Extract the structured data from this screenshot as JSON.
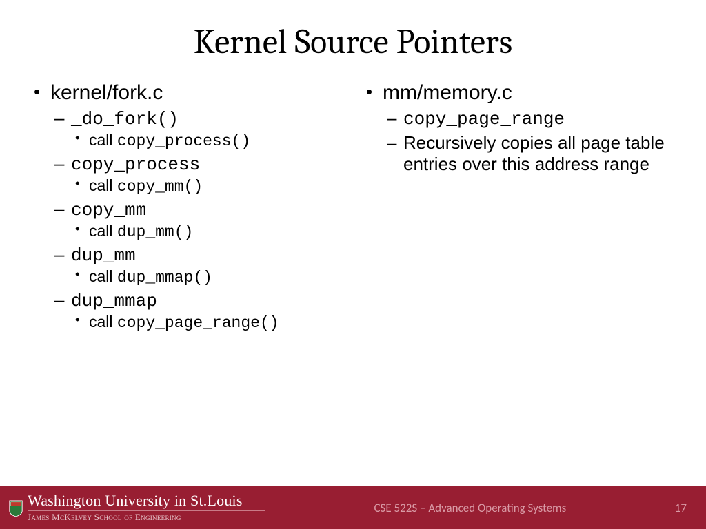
{
  "title": "Kernel Source Pointers",
  "left": {
    "file": "kernel/fork.c",
    "items": [
      {
        "fn": "_do_fork()",
        "call": "copy_process()"
      },
      {
        "fn": "copy_process",
        "call": "copy_mm()"
      },
      {
        "fn": "copy_mm",
        "call": "dup_mm()"
      },
      {
        "fn": "dup_mm",
        "call": "dup_mmap()"
      },
      {
        "fn": "dup_mmap",
        "call": "copy_page_range()"
      }
    ],
    "call_word": "call"
  },
  "right": {
    "file": "mm/memory.c",
    "fn": "copy_page_range",
    "desc": "Recursively copies all page table entries over this address range"
  },
  "footer": {
    "university": "Washington University in St.Louis",
    "school": "James McKelvey School of Engineering",
    "course": "CSE 522S – Advanced Operating Systems",
    "page": "17"
  }
}
